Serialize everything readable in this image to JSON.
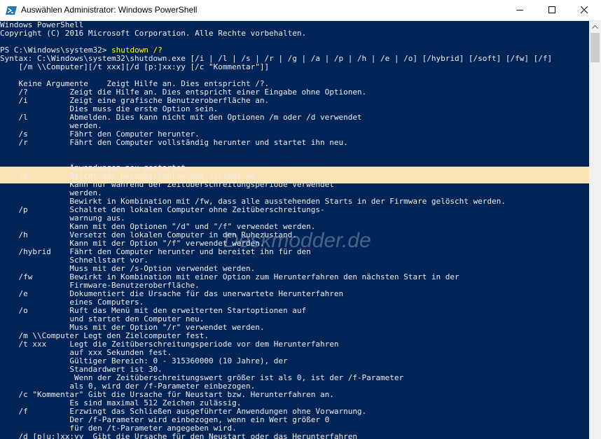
{
  "window": {
    "title": "Auswählen Administrator: Windows PowerShell",
    "icon": "powershell-icon",
    "controls": [
      "minimize-icon",
      "maximize-icon",
      "close-icon"
    ]
  },
  "console": {
    "prompt": "PS C:\\Windows\\system32> ",
    "command": "shutdown /?",
    "lines": [
      "Windows PowerShell",
      "Copyright (C) 2016 Microsoft Corporation. Alle Rechte vorbehalten.",
      "",
      "",
      "Syntax: C:\\Windows\\system32\\shutdown.exe [/i | /l | /s | /r | /g | /a | /p | /h | /e | /o] [/hybrid] [/soft] [/fw] [/f]",
      "    [/m \\\\Computer][/t xxx][/d [p:]xx:yy [/c \"Kommentar\"]]",
      "",
      "    Keine Argumente    Zeigt Hilfe an. Dies entspricht /?.",
      "    /?         Zeigt die Hilfe an. Dies entspricht einer Eingabe ohne Optionen.",
      "    /i         Zeigt eine grafische Benutzeroberfläche an.",
      "               Dies muss die erste Option sein.",
      "    /l         Abmelden. Dies kann nicht mit den Optionen /m oder /d verwendet",
      "               werden.",
      "    /s         Fährt den Computer herunter.",
      "    /r         Fährt den Computer vollständig herunter und startet ihn neu.",
      "    /g         Fährt den Computer vollständig herunter und startet ihn neu.",
      "               Nach dem Neustart des Systems werden die registrierten",
      "               Anwendungen neu gestartet.",
      "    /a         Bricht das Herunterfahren des Systems ab.",
      "               Kann nur während der Zeitüberschreitungsperiode verwendet",
      "               werden.",
      "               Bewirkt in Kombination mit /fw, dass alle ausstehenden Starts in der Firmware gelöscht werden.",
      "    /p         Schaltet den lokalen Computer ohne Zeitüberschreitungs-",
      "               warnung aus.",
      "               Kann mit den Optionen \"/d\" und \"/f\" verwendet werden.",
      "    /h         Versetzt den lokalen Computer in den Ruhezustand.",
      "               Kann mit der Option \"/f\" verwendet werden.",
      "    /hybrid    Fährt den Computer herunter und bereitet ihn für den",
      "               Schnellstart vor.",
      "               Muss mit der /s-Option verwendet werden.",
      "    /fw        Bewirkt in Kombination mit einer Option zum Herunterfahren den nächsten Start in der",
      "               Firmware-Benutzeroberfläche.",
      "    /e         Dokumentiert die Ursache für das unerwartete Herunterfahren",
      "               eines Computers.",
      "    /o         Ruft das Menü mit den erweiterten Startoptionen auf",
      "               und startet den Computer neu.",
      "               Muss mit der Option \"/r\" verwendet werden.",
      "    /m \\\\Computer Legt den Zielcomputer fest.",
      "    /t xxx     Legt die Zeitüberschreitungsperiode vor dem Herunterfahren",
      "               auf xxx Sekunden fest.",
      "               Gültiger Bereich: 0 - 315360000 (10 Jahre), der",
      "               Standardwert ist 30.",
      "                Wenn der Zeitüberschreitungswert größer ist als 0, ist der /f-Parameter",
      "               als 0, wird der /f-Parameter einbezogen.",
      "    /c \"Kommentar\" Gibt die Ursache für Neustart bzw. Herunterfahren an.",
      "               Es sind maximal 512 Zeichen zulässig.",
      "    /f         Erzwingt das Schließen ausgeführter Anwendungen ohne Vorwarnung.",
      "               Der /f-Parameter wird einbezogen, wenn ein Wert größer 0",
      "               für den /t-Parameter angegeben wird.",
      "    /d [p|u:]xx:yy  Gibt die Ursache für den Neustart oder das Herunterfahren"
    ],
    "highlighted_lines": [
      15,
      16
    ],
    "watermark": "Deskmodder.de"
  },
  "colors": {
    "background": "#012456",
    "text": "#eeedf0",
    "command": "#ffff00",
    "selection": "#fbe3b6"
  }
}
